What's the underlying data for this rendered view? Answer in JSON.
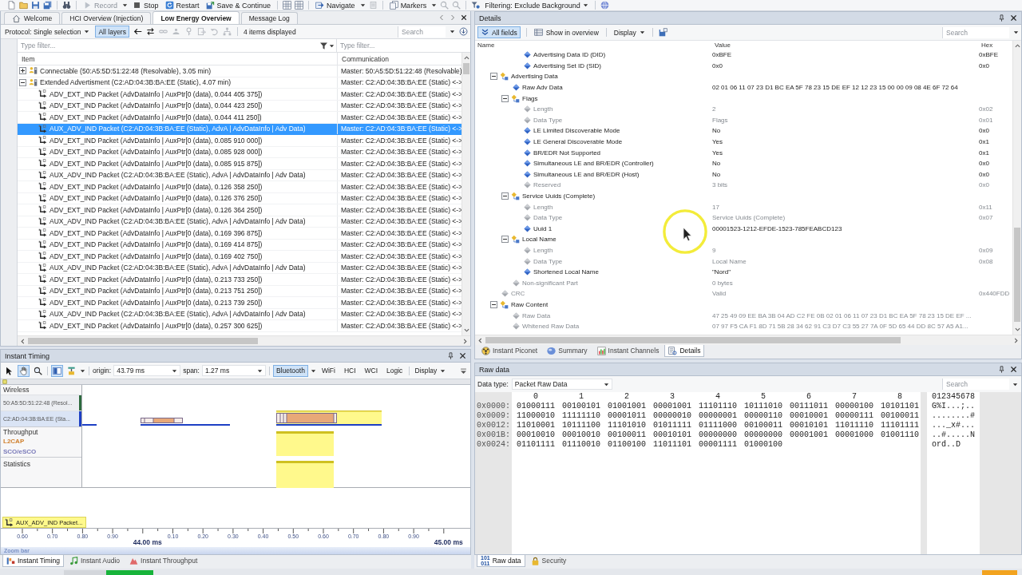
{
  "toolbar": {
    "buttons": [
      {
        "label": "Record",
        "disabled": true
      },
      {
        "label": "Stop",
        "disabled": false
      },
      {
        "label": "Restart",
        "disabled": false
      },
      {
        "label": "Save & Continue",
        "disabled": false
      },
      {
        "label": "Navigate",
        "disabled": false
      },
      {
        "label": "Markers",
        "disabled": false
      }
    ],
    "filtering": "Filtering: Exclude Background"
  },
  "overview": {
    "tabs": [
      {
        "label": "Welcome",
        "selected": false
      },
      {
        "label": "HCI Overview (Injection)",
        "selected": false
      },
      {
        "label": "Low Energy Overview",
        "selected": true
      },
      {
        "label": "Message Log",
        "selected": false
      }
    ],
    "protocol": "Protocol: Single selection",
    "layers": {
      "label": "All layers",
      "selected": true
    },
    "count": "4 items displayed",
    "search": {
      "placeholder": "Search"
    },
    "filters": [
      {
        "placeholder": "Type filter..."
      },
      {
        "placeholder": "Type filter..."
      }
    ],
    "columns": [
      "Item",
      "Communication"
    ],
    "rows": [
      {
        "kind": "group",
        "item": "Connectable (50:A5:5D:51:22:48 (Resolvable), 3.05 min)",
        "communication": "Master: 50:A5:5D:51:22:48 (Resolvable)",
        "expanded": false,
        "selected": false
      },
      {
        "kind": "group",
        "item": "Extended Advertisment (C2:AD:04:3B:BA:EE (Static), 4.07 min)",
        "communication": "Master: C2:AD:04:3B:BA:EE (Static) <->",
        "expanded": true,
        "selected": false,
        "children": [
          {
            "kind": "packet",
            "item": "ADV_EXT_IND Packet (AdvDataInfo | AuxPtr[0 (data), 0.044 405 375])",
            "communication": "Master: C2:AD:04:3B:BA:EE (Static) <->",
            "selected": false
          },
          {
            "kind": "packet",
            "item": "ADV_EXT_IND Packet (AdvDataInfo | AuxPtr[0 (data), 0.044 423 250])",
            "communication": "Master: C2:AD:04:3B:BA:EE (Static) <->",
            "selected": false
          },
          {
            "kind": "packet",
            "item": "ADV_EXT_IND Packet (AdvDataInfo | AuxPtr[0 (data), 0.044 411 250])",
            "communication": "Master: C2:AD:04:3B:BA:EE (Static) <->",
            "selected": false
          },
          {
            "kind": "packet",
            "item": "AUX_ADV_IND Packet (C2:AD:04:3B:BA:EE (Static), AdvA | AdvDataInfo | Adv Data)",
            "communication": "Master: C2:AD:04:3B:BA:EE (Static) <->",
            "selected": true
          },
          {
            "kind": "packet",
            "item": "ADV_EXT_IND Packet (AdvDataInfo | AuxPtr[0 (data), 0.085 910 000])",
            "communication": "Master: C2:AD:04:3B:BA:EE (Static) <->",
            "selected": false
          },
          {
            "kind": "packet",
            "item": "ADV_EXT_IND Packet (AdvDataInfo | AuxPtr[0 (data), 0.085 928 000])",
            "communication": "Master: C2:AD:04:3B:BA:EE (Static) <->",
            "selected": false
          },
          {
            "kind": "packet",
            "item": "ADV_EXT_IND Packet (AdvDataInfo | AuxPtr[0 (data), 0.085 915 875])",
            "communication": "Master: C2:AD:04:3B:BA:EE (Static) <->",
            "selected": false
          },
          {
            "kind": "packet",
            "item": "AUX_ADV_IND Packet (C2:AD:04:3B:BA:EE (Static), AdvA | AdvDataInfo | Adv Data)",
            "communication": "Master: C2:AD:04:3B:BA:EE (Static) <->",
            "selected": false
          },
          {
            "kind": "packet",
            "item": "ADV_EXT_IND Packet (AdvDataInfo | AuxPtr[0 (data), 0.126 358 250])",
            "communication": "Master: C2:AD:04:3B:BA:EE (Static) <->",
            "selected": false
          },
          {
            "kind": "packet",
            "item": "ADV_EXT_IND Packet (AdvDataInfo | AuxPtr[0 (data), 0.126 376 250])",
            "communication": "Master: C2:AD:04:3B:BA:EE (Static) <->",
            "selected": false
          },
          {
            "kind": "packet",
            "item": "ADV_EXT_IND Packet (AdvDataInfo | AuxPtr[0 (data), 0.126 364 250])",
            "communication": "Master: C2:AD:04:3B:BA:EE (Static) <->",
            "selected": false
          },
          {
            "kind": "packet",
            "item": "AUX_ADV_IND Packet (C2:AD:04:3B:BA:EE (Static), AdvA | AdvDataInfo | Adv Data)",
            "communication": "Master: C2:AD:04:3B:BA:EE (Static) <->",
            "selected": false
          },
          {
            "kind": "packet",
            "item": "ADV_EXT_IND Packet (AdvDataInfo | AuxPtr[0 (data), 0.169 396 875])",
            "communication": "Master: C2:AD:04:3B:BA:EE (Static) <->",
            "selected": false
          },
          {
            "kind": "packet",
            "item": "ADV_EXT_IND Packet (AdvDataInfo | AuxPtr[0 (data), 0.169 414 875])",
            "communication": "Master: C2:AD:04:3B:BA:EE (Static) <->",
            "selected": false
          },
          {
            "kind": "packet",
            "item": "ADV_EXT_IND Packet (AdvDataInfo | AuxPtr[0 (data), 0.169 402 750])",
            "communication": "Master: C2:AD:04:3B:BA:EE (Static) <->",
            "selected": false
          },
          {
            "kind": "packet",
            "item": "AUX_ADV_IND Packet (C2:AD:04:3B:BA:EE (Static), AdvA | AdvDataInfo | Adv Data)",
            "communication": "Master: C2:AD:04:3B:BA:EE (Static) <->",
            "selected": false
          },
          {
            "kind": "packet",
            "item": "ADV_EXT_IND Packet (AdvDataInfo | AuxPtr[0 (data), 0.213 733 250])",
            "communication": "Master: C2:AD:04:3B:BA:EE (Static) <->",
            "selected": false
          },
          {
            "kind": "packet",
            "item": "ADV_EXT_IND Packet (AdvDataInfo | AuxPtr[0 (data), 0.213 751 250])",
            "communication": "Master: C2:AD:04:3B:BA:EE (Static) <->",
            "selected": false
          },
          {
            "kind": "packet",
            "item": "ADV_EXT_IND Packet (AdvDataInfo | AuxPtr[0 (data), 0.213 739 250])",
            "communication": "Master: C2:AD:04:3B:BA:EE (Static) <->",
            "selected": false
          },
          {
            "kind": "packet",
            "item": "AUX_ADV_IND Packet (C2:AD:04:3B:BA:EE (Static), AdvA | AdvDataInfo | Adv Data)",
            "communication": "Master: C2:AD:04:3B:BA:EE (Static) <->",
            "selected": false
          },
          {
            "kind": "packet",
            "item": "ADV_EXT_IND Packet (AdvDataInfo | AuxPtr[0 (data), 0.257 300 625])",
            "communication": "Master: C2:AD:04:3B:BA:EE (Static) <->",
            "selected": false
          }
        ]
      }
    ]
  },
  "details": {
    "title": "Details",
    "all_fields": {
      "label": "All fields",
      "selected": true
    },
    "show_in_overview": "Show in overview",
    "display": "Display",
    "search": {
      "placeholder": "Search"
    },
    "columns": [
      "Name",
      "Value",
      "Hex"
    ],
    "tree": [
      {
        "children": [
          {
            "children": [
              {
                "kind": "field",
                "name": "Advertising Data ID (DID)",
                "value": "0xBFE",
                "hex": "0xBFE",
                "greyed": false
              },
              {
                "kind": "field",
                "name": "Advertising Set ID (SID)",
                "value": "0x0",
                "hex": "0x0",
                "greyed": false
              }
            ]
          }
        ]
      },
      {
        "kind": "group",
        "name": "Advertising Data",
        "expanded": true,
        "children": [
          {
            "kind": "field",
            "name": "Raw Adv Data",
            "value": "02 01 06 11 07 23 D1 BC EA 5F 78 23 15 DE EF 12 12 23 15 00 00 09 08 4E 6F 72 64",
            "greyed": false
          },
          {
            "kind": "group",
            "name": "Flags",
            "expanded": true,
            "children": [
              {
                "kind": "field",
                "name": "Length",
                "value": "2",
                "hex": "0x02",
                "greyed": true
              },
              {
                "kind": "field",
                "name": "Data Type",
                "value": "Flags",
                "hex": "0x01",
                "greyed": true
              },
              {
                "kind": "field",
                "name": "LE Limited Discoverable Mode",
                "value": "No",
                "hex": "0x0",
                "greyed": false
              },
              {
                "kind": "field",
                "name": "LE General Discoverable Mode",
                "value": "Yes",
                "hex": "0x1",
                "greyed": false
              },
              {
                "kind": "field",
                "name": "BR/EDR Not Supported",
                "value": "Yes",
                "hex": "0x1",
                "greyed": false
              },
              {
                "kind": "field",
                "name": "Simultaneous LE and BR/EDR (Controller)",
                "value": "No",
                "hex": "0x0",
                "greyed": false
              },
              {
                "kind": "field",
                "name": "Simultaneous LE and BR/EDR (Host)",
                "value": "No",
                "hex": "0x0",
                "greyed": false
              },
              {
                "kind": "field",
                "name": "Reserved",
                "value": "3 bits",
                "hex": "0x0",
                "greyed": true
              }
            ]
          },
          {
            "kind": "group",
            "name": "Service Uuids (Complete)",
            "expanded": true,
            "children": [
              {
                "kind": "field",
                "name": "Length",
                "value": "17",
                "hex": "0x11",
                "greyed": true
              },
              {
                "kind": "field",
                "name": "Data Type",
                "value": "Service Uuids (Complete)",
                "hex": "0x07",
                "greyed": true
              },
              {
                "kind": "field",
                "name": "Uuid 1",
                "value": "00001523-1212-EFDE-1523-785FEABCD123",
                "greyed": false
              }
            ]
          },
          {
            "kind": "group",
            "name": "Local Name",
            "expanded": true,
            "children": [
              {
                "kind": "field",
                "name": "Length",
                "value": "9",
                "hex": "0x09",
                "greyed": true
              },
              {
                "kind": "field",
                "name": "Data Type",
                "value": "Local Name",
                "hex": "0x08",
                "greyed": true
              },
              {
                "kind": "field",
                "name": "Shortened Local Name",
                "value": "\"Nord\"",
                "greyed": false
              }
            ]
          },
          {
            "kind": "field",
            "name": "Non-significant Part",
            "value": "0 bytes",
            "greyed": true
          }
        ]
      },
      {
        "kind": "field",
        "name": "CRC",
        "value": "Valid",
        "hex": "0x440FDD",
        "greyed": true
      },
      {
        "kind": "group",
        "name": "Raw Content",
        "expanded": true,
        "children": [
          {
            "kind": "field",
            "name": "Raw Data",
            "value": "47 25 49 09 EE BA 3B 04 AD C2 FE 0B 02 01 06 11 07 23 D1 BC EA 5F 78 23 15 DE EF ...",
            "greyed": true
          },
          {
            "kind": "field",
            "name": "Whitened Raw Data",
            "value": "07 97 F5 CA F1 8D 71 5B 28 34 62 91 C3 D7 C3 55 27 7A 0F 5D 65 44 DD 8C 57 A5 A1...",
            "greyed": true
          }
        ]
      }
    ],
    "tabs": [
      {
        "label": "Instant Piconet",
        "selected": false
      },
      {
        "label": "Summary",
        "selected": false
      },
      {
        "label": "Instant Channels",
        "selected": false
      },
      {
        "label": "Details",
        "selected": true
      }
    ]
  },
  "timing": {
    "title": "Instant Timing",
    "tools": [
      {
        "kind": "pointer",
        "selected": false
      },
      {
        "kind": "hand",
        "selected": true
      },
      {
        "kind": "zoom",
        "selected": false
      },
      {
        "kind": "panes",
        "selected": true
      },
      {
        "kind": "stamp",
        "selected": false
      }
    ],
    "origin": {
      "label": "origin:",
      "value": "43.79 ms"
    },
    "span": {
      "label": "span:",
      "value": "1.27 ms"
    },
    "filters": [
      {
        "label": "Bluetooth",
        "selected": true
      },
      {
        "label": "WiFi",
        "selected": false
      },
      {
        "label": "HCI",
        "selected": false
      },
      {
        "label": "WCI",
        "selected": false
      },
      {
        "label": "Logic",
        "selected": false
      }
    ],
    "display": "Display",
    "lanes": [
      {
        "kind": "section",
        "label": "Wireless"
      },
      {
        "kind": "device",
        "label": "50:A5:5D:51:22:48 (Resol...",
        "selected": false,
        "color": "#2d6a3e"
      },
      {
        "kind": "device",
        "label": "C2:AD:04:3B:BA:EE (Sta...",
        "selected": true,
        "color": "#1d3fc4"
      },
      {
        "kind": "section",
        "label": "Throughput"
      },
      {
        "kind": "series",
        "label": "L2CAP",
        "color": "#d0802e"
      },
      {
        "kind": "series",
        "label": "SCO/eSCO",
        "color": "#7878b8"
      },
      {
        "kind": "section",
        "label": "Statistics"
      }
    ],
    "legend": "AUX_ADV_IND Packet...",
    "ticks": [
      {
        "kind": "minor",
        "label": "0.60"
      },
      {
        "kind": "minor",
        "label": "0.70"
      },
      {
        "kind": "minor",
        "label": "0.80"
      },
      {
        "kind": "minor",
        "label": "0.90"
      },
      {
        "kind": "major",
        "label": "44.00 ms"
      },
      {
        "kind": "minor",
        "label": "0.10"
      },
      {
        "kind": "minor",
        "label": "0.20"
      },
      {
        "kind": "minor",
        "label": "0.30"
      },
      {
        "kind": "minor",
        "label": "0.40"
      },
      {
        "kind": "minor",
        "label": "0.50"
      },
      {
        "kind": "minor",
        "label": "0.60"
      },
      {
        "kind": "minor",
        "label": "0.70"
      },
      {
        "kind": "minor",
        "label": "0.80"
      },
      {
        "kind": "minor",
        "label": "0.90"
      },
      {
        "kind": "major",
        "label": "45.00 ms"
      }
    ],
    "zoom_bar": "Zoom bar",
    "tabs": [
      {
        "label": "Instant Timing",
        "selected": true
      },
      {
        "label": "Instant Audio",
        "selected": false
      },
      {
        "label": "Instant Throughput",
        "selected": false
      }
    ]
  },
  "raw": {
    "title": "Raw data",
    "data_type": {
      "label": "Data type:",
      "value": "Packet Raw Data"
    },
    "search": {
      "placeholder": "Search"
    },
    "columns": [
      "0",
      "1",
      "2",
      "3",
      "4",
      "5",
      "6",
      "7",
      "8"
    ],
    "ascii_header": "012345678",
    "rows": [
      {
        "address": "0x0000:",
        "bytes": [
          "01000111",
          "00100101",
          "01001001",
          "00001001",
          "11101110",
          "10111010",
          "00111011",
          "00000100",
          "10101101"
        ],
        "ascii": "G%I...;.."
      },
      {
        "address": "0x0009:",
        "bytes": [
          "11000010",
          "11111110",
          "00001011",
          "00000010",
          "00000001",
          "00000110",
          "00010001",
          "00000111",
          "00100011"
        ],
        "ascii": "........#"
      },
      {
        "address": "0x0012:",
        "bytes": [
          "11010001",
          "10111100",
          "11101010",
          "01011111",
          "01111000",
          "00100011",
          "00010101",
          "11011110",
          "11101111"
        ],
        "ascii": "..._x#..."
      },
      {
        "address": "0x001B:",
        "bytes": [
          "00010010",
          "00010010",
          "00100011",
          "00010101",
          "00000000",
          "00000000",
          "00001001",
          "00001000",
          "01001110"
        ],
        "ascii": "..#.....N"
      },
      {
        "address": "0x0024:",
        "bytes": [
          "01101111",
          "01110010",
          "01100100",
          "11011101",
          "00001111",
          "01000100"
        ],
        "ascii": "ord..D"
      }
    ],
    "tabs": [
      {
        "label": "Raw data",
        "icon_text": [
          "101",
          "011"
        ],
        "selected": true
      },
      {
        "label": "Security",
        "selected": false
      }
    ]
  }
}
